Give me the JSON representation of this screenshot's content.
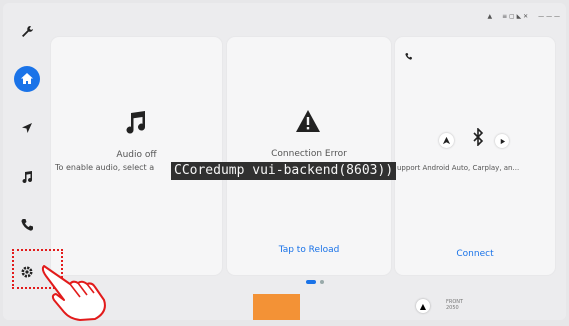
{
  "sidebar": {
    "items": [
      {
        "name": "wrench-icon"
      },
      {
        "name": "home-icon"
      },
      {
        "name": "navigation-icon"
      },
      {
        "name": "music-icon"
      },
      {
        "name": "phone-icon"
      },
      {
        "name": "settings-icon"
      }
    ]
  },
  "status": {
    "items": [
      "▲",
      "≡ ▢ ◣ ✕",
      "— — —"
    ]
  },
  "cards": {
    "audio": {
      "title": "Audio off",
      "subtitle": "To enable audio, select a"
    },
    "connection": {
      "title": "Connection Error",
      "action": "Tap to Reload"
    },
    "phone": {
      "subtitle": "upport Android Auto, Carplay, an...",
      "action": "Connect"
    }
  },
  "overlay": {
    "text": "CCoredump vui-backend(8603))"
  },
  "pager": {
    "count": 2,
    "active": 0
  },
  "bottom_bar": {
    "seat_label": "FRONT",
    "seat_sub": "2050"
  },
  "colors": {
    "accent": "#1a73e8",
    "orange": "#f39236",
    "highlight": "#e21b1b"
  }
}
